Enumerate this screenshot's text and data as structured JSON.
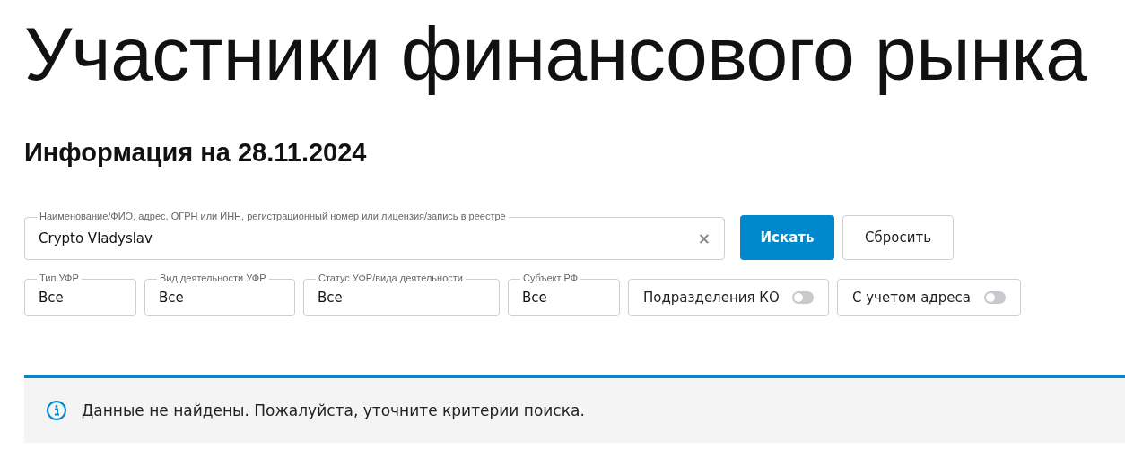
{
  "title": "Участники финансового рынка",
  "subtitle": "Информация на 28.11.2024",
  "search": {
    "label": "Наименование/ФИО, адрес, ОГРН или ИНН, регистрационный номер или лицензия/запись в реестре",
    "value": "Crypto Vladyslav",
    "clear": "×"
  },
  "buttons": [
    {
      "label": "Искать",
      "kind": "primary"
    },
    {
      "label": "Сбросить",
      "kind": "secondary"
    }
  ],
  "filters": [
    {
      "label": "Тип УФР",
      "value": "Все"
    },
    {
      "label": "Вид деятельности УФР",
      "value": "Все"
    },
    {
      "label": "Статус УФР/вида деятельности",
      "value": "Все"
    },
    {
      "label": "Субъект РФ",
      "value": "Все"
    }
  ],
  "toggles": [
    {
      "label": "Подразделения КО",
      "on": false
    },
    {
      "label": "С учетом адреса",
      "on": false
    }
  ],
  "notice": {
    "text": "Данные не найдены. Пожалуйста, уточните критерии поиска."
  }
}
